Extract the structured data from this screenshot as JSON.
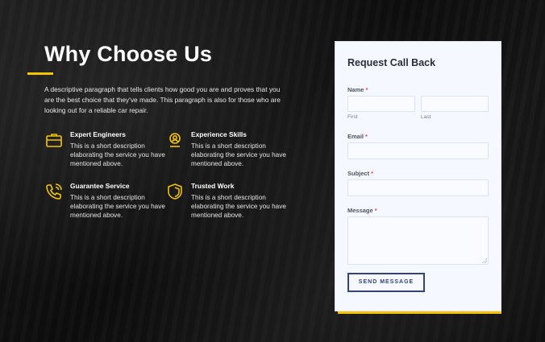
{
  "section": {
    "title": "Why Choose Us",
    "intro": "A descriptive paragraph that tells clients how good you are and proves that you are the best choice that they've made. This paragraph is also for those who are looking out for a reliable car repair."
  },
  "features": [
    {
      "title": "Expert Engineers",
      "description": "This is a short description elaborating the service you have mentioned above.",
      "icon": "briefcase-icon"
    },
    {
      "title": "Experience Skills",
      "description": "This is a short description elaborating the service you have mentioned above.",
      "icon": "user-badge-icon"
    },
    {
      "title": "Guarantee Service",
      "description": "This is a short description elaborating the service you have mentioned above.",
      "icon": "phone-call-icon"
    },
    {
      "title": "Trusted Work",
      "description": "This is a short description elaborating the service you have mentioned above.",
      "icon": "shield-icon"
    }
  ],
  "form": {
    "title": "Request Call Back",
    "name_label": "Name",
    "first_sublabel": "First",
    "last_sublabel": "Last",
    "email_label": "Email",
    "subject_label": "Subject",
    "message_label": "Message",
    "required_mark": "*",
    "submit_label": "SEND MESSAGE",
    "first_value": "",
    "last_value": "",
    "email_value": "",
    "subject_value": "",
    "message_value": ""
  },
  "colors": {
    "accent": "#f5c400",
    "button_border": "#34447a",
    "required": "#e24b4b",
    "form_bg": "#f6f8ff"
  }
}
